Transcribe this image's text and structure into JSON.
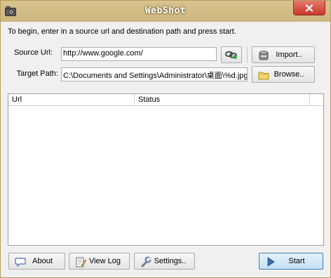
{
  "window": {
    "title": "WebShot"
  },
  "instruction": "To begin, enter in a source url and destination path and press start.",
  "source": {
    "label": "Source Url:",
    "value": "http://www.google.com/"
  },
  "target": {
    "label": "Target Path:",
    "value": "C:\\Documents and Settings\\Administrator\\桌面\\%d.jpg"
  },
  "buttons": {
    "import": "Import..",
    "browse": "Browse..",
    "about": "About",
    "view_log": "View Log",
    "settings": "Settings..",
    "start": "Start"
  },
  "list": {
    "columns": [
      "Url",
      "Status"
    ]
  },
  "colors": {
    "titlebar": "#cdb67f",
    "close": "#c7392b",
    "start_button": "#cfe4f7"
  }
}
